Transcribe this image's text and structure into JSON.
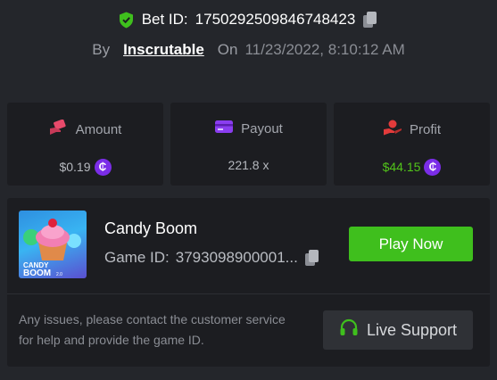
{
  "bet": {
    "id_label": "Bet ID:",
    "id_value": "1750292509846748423",
    "by_label": "By",
    "user": "Inscrutable",
    "on_label": "On",
    "datetime": "11/23/2022, 8:10:12 AM"
  },
  "stats": {
    "amount": {
      "label": "Amount",
      "value": "$0.19"
    },
    "payout": {
      "label": "Payout",
      "value": "221.8 x"
    },
    "profit": {
      "label": "Profit",
      "value": "$44.15"
    }
  },
  "currency_symbol": "₵",
  "game": {
    "name": "Candy Boom",
    "id_label": "Game ID:",
    "id_value": "3793098900001...",
    "thumb_line1": "CANDY",
    "thumb_line2": "BOOM",
    "thumb_tag": "2.0",
    "play_label": "Play Now",
    "help_text": "Any issues, please contact the customer service for help and provide the game ID.",
    "support_label": "Live Support"
  },
  "colors": {
    "background": "#24262b",
    "card": "#1c1d21",
    "accent_green": "#3fbf1d",
    "profit_green": "#52c41a",
    "coin_purple": "#7b2de8",
    "amount_icon": "#e84a6b",
    "payout_icon": "#8a3df0",
    "profit_icon": "#e23b3b"
  },
  "icons": [
    "shield-check-icon",
    "copy-icon",
    "wallet-hand-icon",
    "card-icon",
    "profit-hand-icon",
    "coin-icon",
    "headset-icon"
  ]
}
